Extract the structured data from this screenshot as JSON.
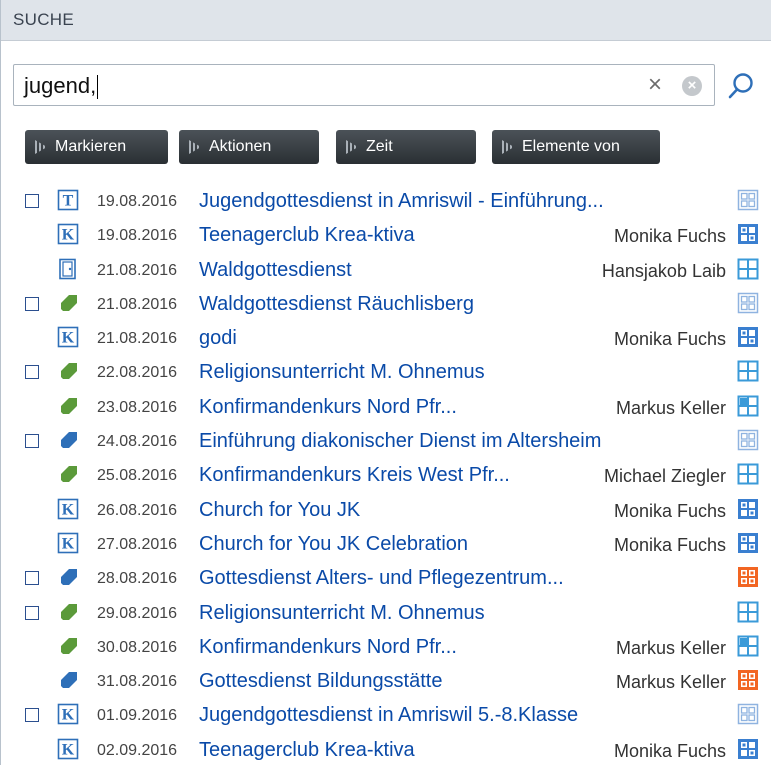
{
  "header": {
    "title": "SUCHE"
  },
  "search": {
    "value": "jugend,",
    "clear_symbol": "×",
    "clear_all_symbol": "×"
  },
  "toolbar": {
    "buttons": [
      {
        "label": "Markieren"
      },
      {
        "label": "Aktionen"
      },
      {
        "label": "Zeit"
      },
      {
        "label": "Elemente von"
      }
    ]
  },
  "colors": {
    "link": "#0a4aa8",
    "orange": "#f26522",
    "blue_grid": "#3a7fd0",
    "tag_green": "#5b9a3a",
    "tag_blue": "#2e6fb8"
  },
  "results": [
    {
      "checkbox": true,
      "icon": "T",
      "date": "19.08.2016",
      "title": "Jugendgottesdienst in Amriswil - Einführung...",
      "person": "",
      "grid": "light-grid-icon"
    },
    {
      "checkbox": false,
      "icon": "K",
      "date": "19.08.2016",
      "title": "Teenagerclub Krea-ktiva",
      "person": "Monika Fuchs",
      "grid": "blue-grid-icon"
    },
    {
      "checkbox": false,
      "icon": "door",
      "date": "21.08.2016",
      "title": "Waldgottesdienst",
      "person": "Hansjakob Laib",
      "grid": "blue-window-icon"
    },
    {
      "checkbox": true,
      "icon": "tag-green",
      "date": "21.08.2016",
      "title": "Waldgottesdienst Räuchlisberg",
      "person": "",
      "grid": "light-grid-icon"
    },
    {
      "checkbox": false,
      "icon": "K",
      "date": "21.08.2016",
      "title": "godi",
      "person": "Monika Fuchs",
      "grid": "blue-grid-icon"
    },
    {
      "checkbox": true,
      "icon": "tag-green",
      "date": "22.08.2016",
      "title": "Religionsunterricht M. Ohnemus",
      "person": "",
      "grid": "blue-window-icon"
    },
    {
      "checkbox": false,
      "icon": "tag-green",
      "date": "23.08.2016",
      "title": "Konfirmandenkurs Nord Pfr...",
      "person": "Markus Keller",
      "grid": "blue-window-half-icon"
    },
    {
      "checkbox": true,
      "icon": "tag-blue",
      "date": "24.08.2016",
      "title": "Einführung diakonischer Dienst im Altersheim",
      "person": "",
      "grid": "light-grid-icon"
    },
    {
      "checkbox": false,
      "icon": "tag-green",
      "date": "25.08.2016",
      "title": "Konfirmandenkurs Kreis West Pfr...",
      "person": "Michael Ziegler",
      "grid": "blue-window-icon"
    },
    {
      "checkbox": false,
      "icon": "K",
      "date": "26.08.2016",
      "title": "Church for You JK",
      "person": "Monika Fuchs",
      "grid": "blue-grid-icon"
    },
    {
      "checkbox": false,
      "icon": "K",
      "date": "27.08.2016",
      "title": "Church for You JK Celebration",
      "person": "Monika Fuchs",
      "grid": "blue-grid-icon"
    },
    {
      "checkbox": true,
      "icon": "tag-blue",
      "date": "28.08.2016",
      "title": "Gottesdienst Alters- und Pflegezentrum...",
      "person": "",
      "grid": "orange-grid-icon"
    },
    {
      "checkbox": true,
      "icon": "tag-green",
      "date": "29.08.2016",
      "title": "Religionsunterricht M. Ohnemus",
      "person": "",
      "grid": "blue-window-icon"
    },
    {
      "checkbox": false,
      "icon": "tag-green",
      "date": "30.08.2016",
      "title": "Konfirmandenkurs Nord Pfr...",
      "person": "Markus Keller",
      "grid": "blue-window-half-icon"
    },
    {
      "checkbox": false,
      "icon": "tag-blue",
      "date": "31.08.2016",
      "title": "Gottesdienst Bildungsstätte",
      "person": "Markus Keller",
      "grid": "orange-grid-icon"
    },
    {
      "checkbox": true,
      "icon": "K",
      "date": "01.09.2016",
      "title": "Jugendgottesdienst in Amriswil 5.-8.Klasse",
      "person": "",
      "grid": "light-grid-icon"
    },
    {
      "checkbox": false,
      "icon": "K",
      "date": "02.09.2016",
      "title": "Teenagerclub Krea-ktiva",
      "person": "Monika Fuchs",
      "grid": "blue-grid-icon"
    }
  ]
}
